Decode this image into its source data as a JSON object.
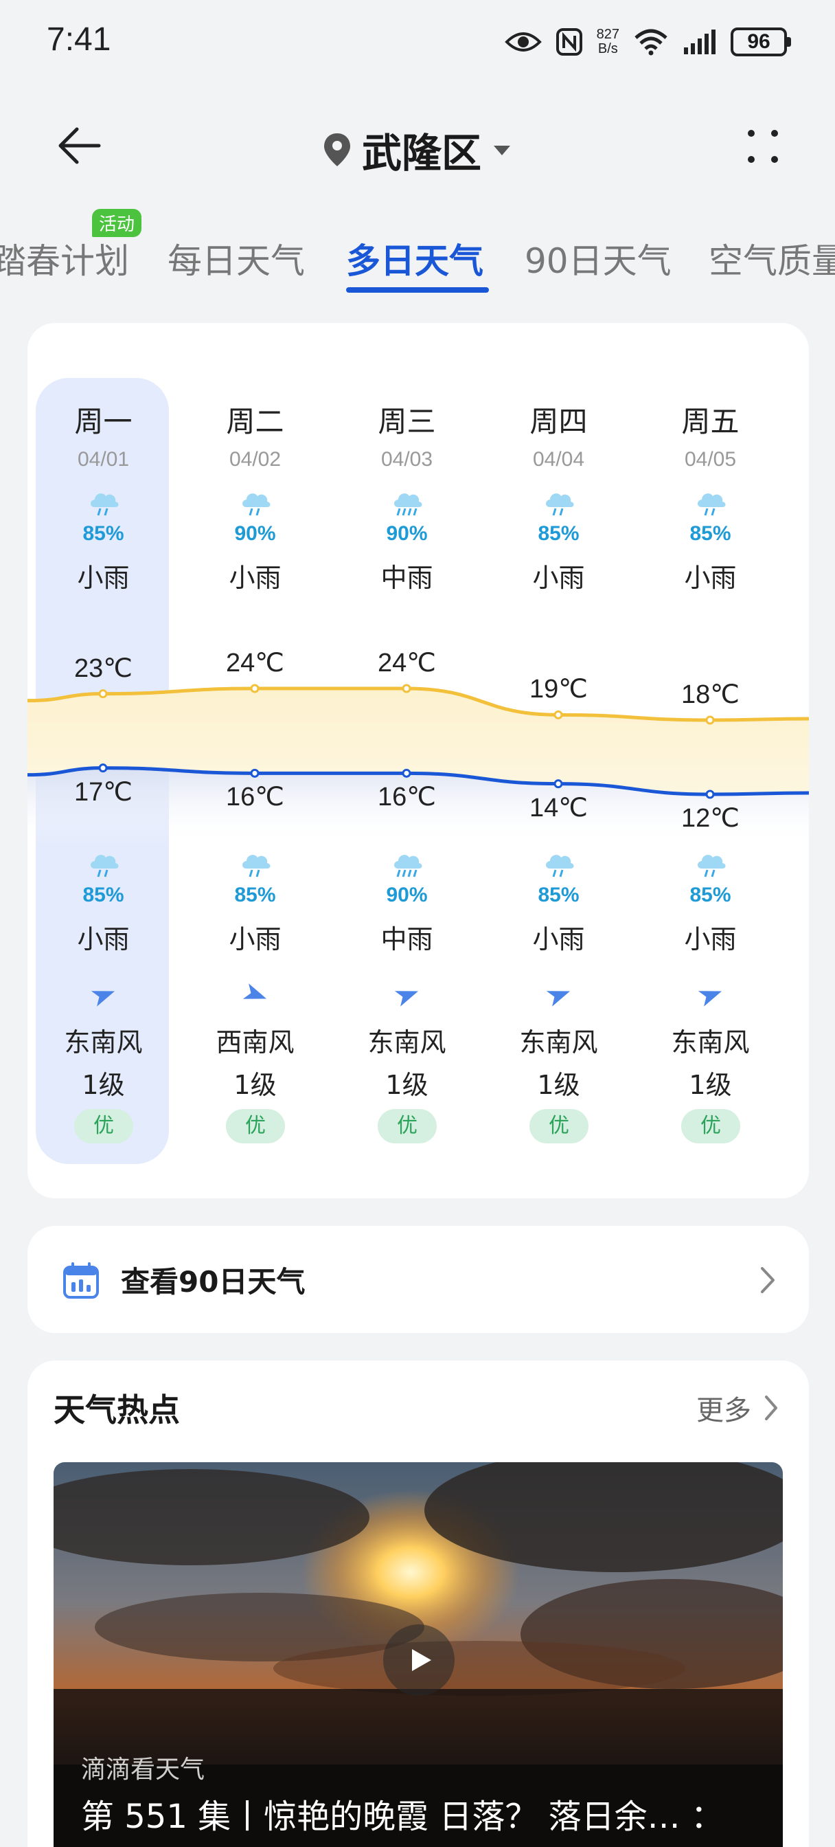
{
  "status_bar": {
    "time": "7:41",
    "net_speed_value": "827",
    "net_speed_unit": "B/s",
    "battery": "96",
    "icons": [
      "eye-icon",
      "nfc-icon",
      "wifi-icon",
      "signal-icon",
      "battery-icon"
    ]
  },
  "header": {
    "location": "武隆区",
    "icons": [
      "back-arrow-icon",
      "location-pin-icon",
      "dropdown-caret-icon",
      "more-dots-icon"
    ]
  },
  "tabs": {
    "items": [
      "踏春计划",
      "每日天气",
      "多日天气",
      "90日天气",
      "空气质量"
    ],
    "active": "多日天气",
    "badge": "活动"
  },
  "forecast": {
    "days": [
      {
        "dow": "周一",
        "date": "04/01",
        "day_pct": "85%",
        "day_cond": "小雨",
        "high": "23℃",
        "low": "17℃",
        "night_pct": "85%",
        "night_cond": "小雨",
        "wind_dir": "东南风",
        "wind_level": "1级",
        "aqi": "优",
        "is_today": true
      },
      {
        "dow": "周二",
        "date": "04/02",
        "day_pct": "90%",
        "day_cond": "小雨",
        "high": "24℃",
        "low": "16℃",
        "night_pct": "85%",
        "night_cond": "小雨",
        "wind_dir": "西南风",
        "wind_level": "1级",
        "aqi": "优",
        "is_today": false
      },
      {
        "dow": "周三",
        "date": "04/03",
        "day_pct": "90%",
        "day_cond": "中雨",
        "high": "24℃",
        "low": "16℃",
        "night_pct": "90%",
        "night_cond": "中雨",
        "wind_dir": "东南风",
        "wind_level": "1级",
        "aqi": "优",
        "is_today": false
      },
      {
        "dow": "周四",
        "date": "04/04",
        "day_pct": "85%",
        "day_cond": "小雨",
        "high": "19℃",
        "low": "14℃",
        "night_pct": "85%",
        "night_cond": "小雨",
        "wind_dir": "东南风",
        "wind_level": "1级",
        "aqi": "优",
        "is_today": false
      },
      {
        "dow": "周五",
        "date": "04/05",
        "day_pct": "85%",
        "day_cond": "小雨",
        "high": "18℃",
        "low": "12℃",
        "night_pct": "85%",
        "night_cond": "小雨",
        "wind_dir": "东南风",
        "wind_level": "1级",
        "aqi": "优",
        "is_today": false
      }
    ],
    "high_values": [
      23,
      24,
      24,
      19,
      18
    ],
    "low_values": [
      17,
      16,
      16,
      14,
      12
    ],
    "colors": {
      "high_line": "#f2c03a",
      "low_line": "#1a57d6",
      "today_bg": "#e4ebfc",
      "pct": "#1e9ad6",
      "aqi_text": "#2ca35a",
      "aqi_bg": "#d5f0e0"
    }
  },
  "ninety_day": {
    "label": "查看90日天气",
    "icon": "calendar-icon"
  },
  "hot": {
    "title": "天气热点",
    "more": "更多",
    "video": {
      "source": "滴滴看天气",
      "title": "第 551 集丨惊艳的晚霞 日落？ 落日余… ："
    }
  }
}
